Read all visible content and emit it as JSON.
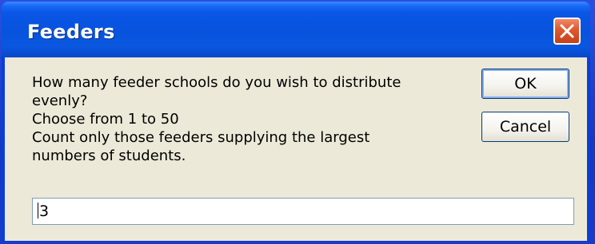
{
  "window": {
    "title": "Feeders",
    "icons": {
      "close": "close-icon"
    },
    "colors": {
      "titlebar": "#0753dd",
      "close_button": "#e25a30",
      "client": "#ece9d8"
    }
  },
  "dialog": {
    "message_lines": [
      "How many feeder schools do you wish to distribute",
      "evenly?",
      "Choose from 1 to 50",
      "Count only those feeders supplying the largest",
      "numbers of students."
    ],
    "ok_label": "OK",
    "cancel_label": "Cancel",
    "input_value": "3"
  }
}
